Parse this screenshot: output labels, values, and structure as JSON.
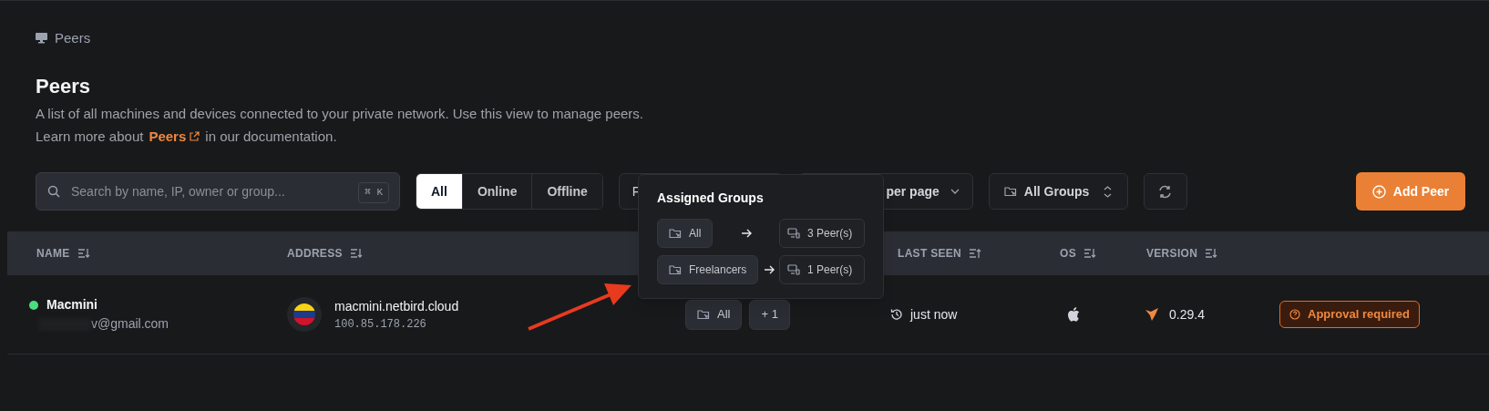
{
  "breadcrumb": {
    "label": "Peers"
  },
  "header": {
    "title": "Peers",
    "description": "A list of all machines and devices connected to your private network. Use this view to manage peers.",
    "learn_more": {
      "before": "Learn more about",
      "link": "Peers",
      "after": "in our documentation."
    }
  },
  "toolbar": {
    "search": {
      "placeholder": "Search by name, IP, owner or group...",
      "shortcut": "⌘ K"
    },
    "filters": [
      {
        "label": "All",
        "selected": true
      },
      {
        "label": "Online",
        "selected": false
      },
      {
        "label": "Offline",
        "selected": false
      }
    ],
    "hidden_button": "F",
    "page_size": "per page",
    "groups_select": "All Groups",
    "add_button": "Add Peer"
  },
  "table": {
    "columns": [
      {
        "label": "NAME",
        "sorted_ascending": false
      },
      {
        "label": "ADDRESS",
        "sorted_ascending": false
      },
      {
        "label": "LAST SEEN",
        "sorted_ascending": true
      },
      {
        "label": "OS",
        "sorted_ascending": false
      },
      {
        "label": "VERSION",
        "sorted_ascending": false
      }
    ],
    "rows": [
      {
        "name": "Macmini",
        "online": true,
        "email": "v@gmail.com",
        "dns": "macmini.netbird.cloud",
        "ip": "100.85.178.226",
        "groups": [
          "All"
        ],
        "more_groups": "+ 1",
        "last_seen": "just now",
        "version": "0.29.4",
        "status": "Approval required"
      }
    ]
  },
  "popover": {
    "title": "Assigned Groups",
    "entries": [
      {
        "group": "All",
        "peers": "3 Peer(s)"
      },
      {
        "group": "Freelancers",
        "peers": "1 Peer(s)"
      }
    ]
  }
}
